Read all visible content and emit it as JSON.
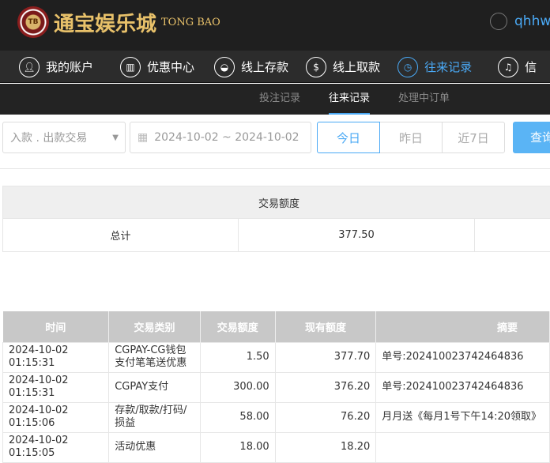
{
  "header": {
    "logo_text": "通宝娱乐城",
    "logo_en": "TONG BAO",
    "logo_chip": "TB",
    "username": "qhhw"
  },
  "nav": [
    {
      "label": "我的账户",
      "icon": "user-icon"
    },
    {
      "label": "优惠中心",
      "icon": "gift-icon"
    },
    {
      "label": "线上存款",
      "icon": "deposit-icon"
    },
    {
      "label": "线上取款",
      "icon": "withdraw-icon"
    },
    {
      "label": "往来记录",
      "icon": "records-icon",
      "active": true
    },
    {
      "label": "信",
      "icon": "bell-icon"
    }
  ],
  "subnav": [
    {
      "label": "投注记录"
    },
    {
      "label": "往来记录",
      "active": true
    },
    {
      "label": "处理中订单"
    }
  ],
  "filter": {
    "type_select": "入款 . 出款交易",
    "date_range": "2024-10-02 ~ 2024-10-02",
    "today": "今日",
    "yesterday": "昨日",
    "last7": "近7日",
    "query": "查询"
  },
  "summary": {
    "header": "交易额度",
    "label": "总计",
    "value": "377.50"
  },
  "table": {
    "columns": [
      "时间",
      "交易类别",
      "交易额度",
      "现有额度",
      "摘要"
    ],
    "rows": [
      [
        "2024-10-02 01:15:31",
        "CGPAY-CG钱包支付笔笔送优惠",
        "1.50",
        "377.70",
        "单号:202410023742464836"
      ],
      [
        "2024-10-02 01:15:31",
        "CGPAY支付",
        "300.00",
        "376.20",
        "单号:202410023742464836"
      ],
      [
        "2024-10-02 01:15:06",
        "存款/取款/打码/损益",
        "58.00",
        "76.20",
        "月月送《每月1号下午14:20领取》"
      ],
      [
        "2024-10-02 01:15:05",
        "活动优惠",
        "18.00",
        "18.20",
        ""
      ]
    ]
  },
  "colors": {
    "accent": "#4aa9f5",
    "header_bg": "#1f1f1f",
    "table_header": "#c8c8c8"
  }
}
